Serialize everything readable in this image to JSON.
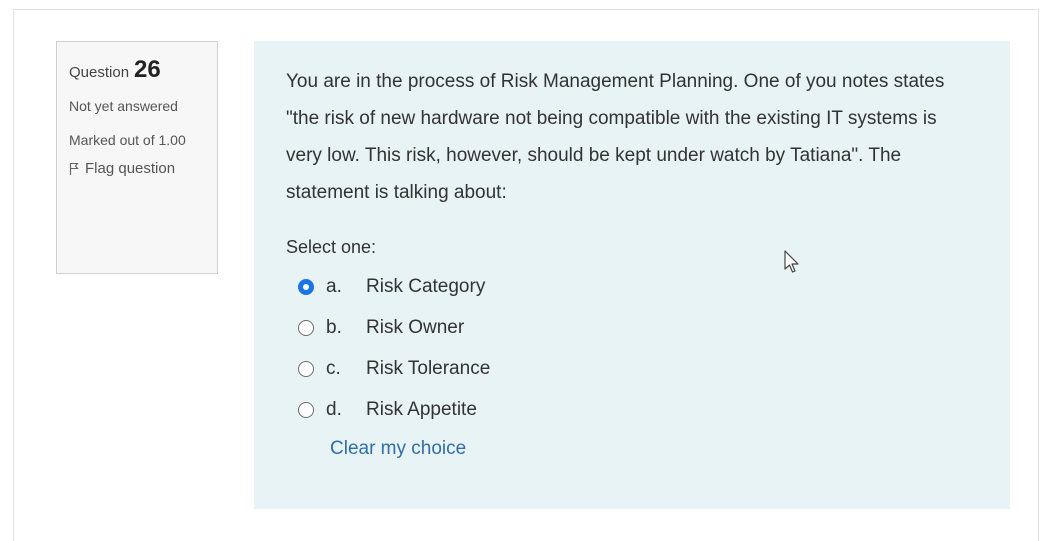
{
  "question_info": {
    "label": "Question",
    "number": "26",
    "state": "Not yet answered",
    "grade": "Marked out of 1.00",
    "flag_label": "Flag question"
  },
  "question": {
    "text": "You are in the process of Risk Management Planning. One of you notes states \"the risk of new hardware not being compatible with the existing IT systems is very low. This risk, however, should be kept under watch by Tatiana\". The statement is talking about:",
    "prompt": "Select one:",
    "answers": [
      {
        "letter": "a.",
        "label": "Risk Category",
        "selected": true
      },
      {
        "letter": "b.",
        "label": "Risk Owner",
        "selected": false
      },
      {
        "letter": "c.",
        "label": "Risk Tolerance",
        "selected": false
      },
      {
        "letter": "d.",
        "label": "Risk Appetite",
        "selected": false
      }
    ],
    "clear_label": "Clear my choice"
  },
  "colors": {
    "content_bg": "#e7f3f5",
    "info_bg": "#f7f7f7",
    "link": "#2f6ea8",
    "radio_selected": "#1a73e8"
  },
  "icons": {
    "flag": "flag-icon",
    "cursor": "mouse-pointer-icon"
  }
}
